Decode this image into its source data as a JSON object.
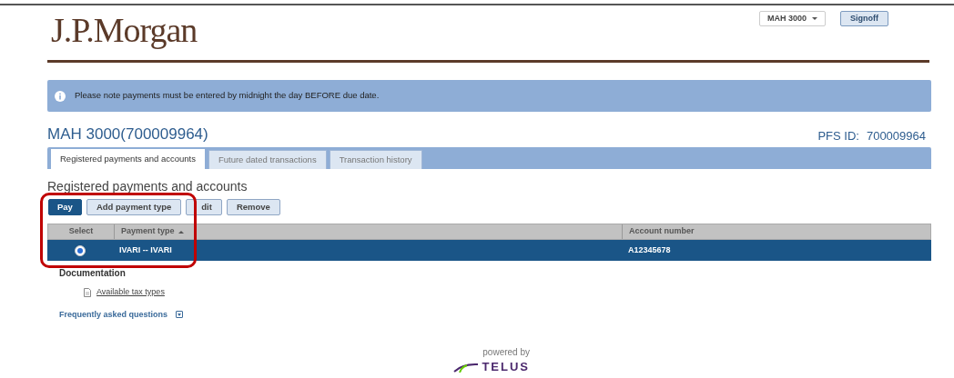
{
  "header": {
    "logo": "J.P.Morgan",
    "account_selector": "MAH 3000",
    "signoff": "Signoff"
  },
  "notice": "Please note payments must be entered by midnight the day BEFORE due date.",
  "account": {
    "title": "MAH 3000(700009964)",
    "pfs_label": "PFS ID:",
    "pfs_value": "700009964"
  },
  "tabs": [
    {
      "label": "Registered payments and accounts",
      "selected": true
    },
    {
      "label": "Future dated transactions",
      "selected": false
    },
    {
      "label": "Transaction history",
      "selected": false
    }
  ],
  "section_title": "Registered payments and accounts",
  "buttons": [
    {
      "label": "Pay",
      "primary": true
    },
    {
      "label": "Add payment type",
      "primary": false
    },
    {
      "label": "dit",
      "primary": false
    },
    {
      "label": "Remove",
      "primary": false
    }
  ],
  "table": {
    "columns": [
      {
        "label": "Select",
        "sorted": false
      },
      {
        "label": "Payment type",
        "sorted": true
      },
      {
        "label": "Account number",
        "sorted": false
      }
    ],
    "rows": [
      {
        "selected": true,
        "payment_type": "IVARI -- IVARI",
        "account_number": "A12345678"
      }
    ]
  },
  "documentation": {
    "heading": "Documentation",
    "link": "Available tax types"
  },
  "faq": "Frequently asked questions",
  "footer": {
    "powered_by": "powered by",
    "brand": "TELUS"
  }
}
